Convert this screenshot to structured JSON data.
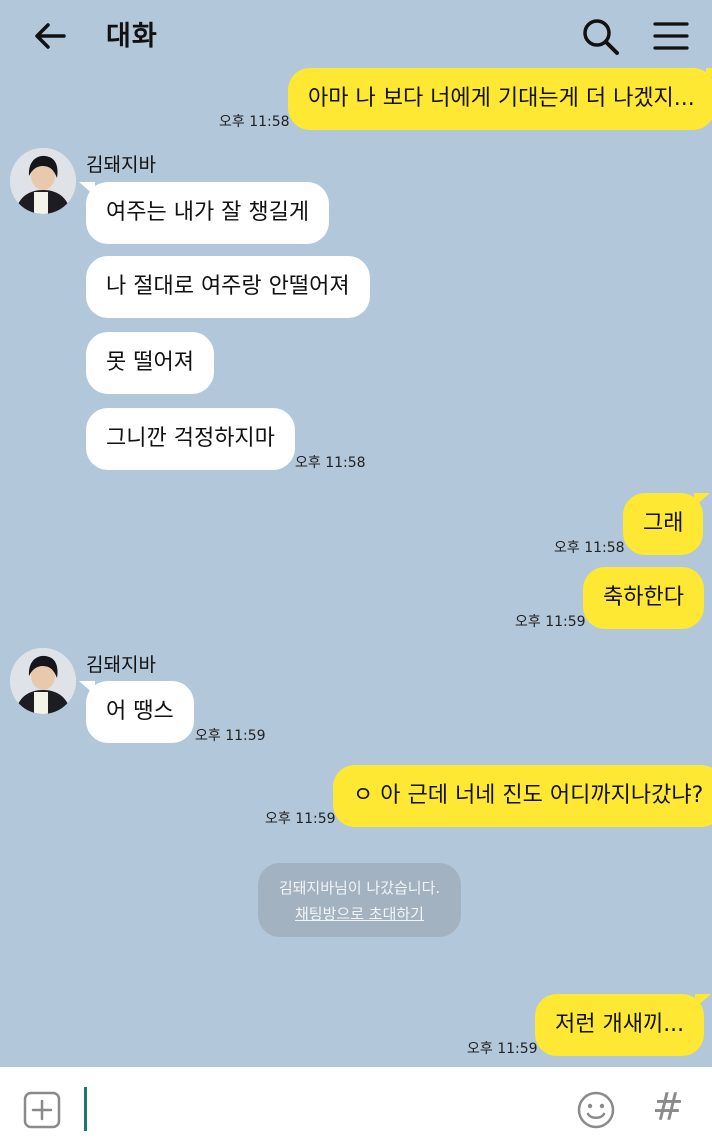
{
  "header": {
    "title": "대화",
    "back_icon": "arrow-left-icon",
    "search_icon": "search-icon",
    "menu_icon": "hamburger-menu-icon"
  },
  "messages": [
    {
      "from": "me",
      "text": "아마 나 보다 너에게 기대는게 더 나겠지...",
      "time": "오후 11:58"
    },
    {
      "from": "other",
      "sender": "김돼지바",
      "text": "여주는 내가 잘 챙길게"
    },
    {
      "from": "other",
      "text": "나 절대로 여주랑 안떨어져"
    },
    {
      "from": "other",
      "text": "못 떨어져"
    },
    {
      "from": "other",
      "text": "그니깐 걱정하지마",
      "time": "오후 11:58"
    },
    {
      "from": "me",
      "text": "그래",
      "time": "오후 11:58"
    },
    {
      "from": "me",
      "text": "축하한다",
      "time": "오후 11:59"
    },
    {
      "from": "other",
      "sender": "김돼지바",
      "text": "어 땡스",
      "time": "오후 11:59"
    },
    {
      "from": "me",
      "text": "ㅇ 아 근데 너네 진도 어디까지나갔냐?",
      "time": "오후 11:59"
    },
    {
      "from": "me",
      "text": "저런 개새끼...",
      "time": "오후 11:59"
    }
  ],
  "system_notice": {
    "text": "김돼지바님이 나갔습니다.",
    "link": "채팅방으로 초대하기"
  },
  "input_bar": {
    "attach_icon": "plus-square-icon",
    "emoji_icon": "smiley-icon",
    "hash_label": "#"
  },
  "colors": {
    "background": "#b2c7da",
    "my_bubble": "#fee833",
    "other_bubble": "#ffffff",
    "notice": "#a2b2c0"
  }
}
